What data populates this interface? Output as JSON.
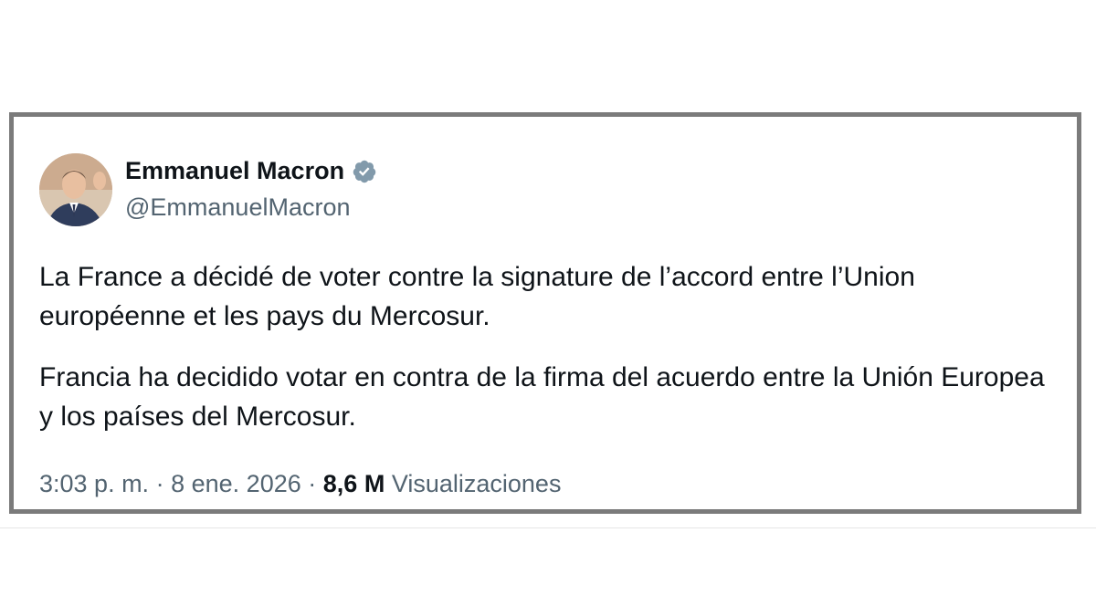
{
  "author": {
    "display_name": "Emmanuel Macron",
    "handle": "@EmmanuelMacron",
    "verified_color": "#829aab"
  },
  "tweet": {
    "text_fr": "La France a décidé de voter contre la signature de l’accord entre l’Union européenne et les pays du Mercosur.",
    "text_es": "Francia ha decidido votar en contra de la firma del acuerdo entre la Unión Europea y los países del Mercosur."
  },
  "meta": {
    "time": "3:03 p. m.",
    "separator": "·",
    "date": "8 ene. 2026",
    "views_count": "8,6 M",
    "views_label": "Visualizaciones"
  },
  "colors": {
    "text_primary": "#0f1419",
    "text_secondary": "#536471",
    "card_border": "#7b7b7b"
  }
}
